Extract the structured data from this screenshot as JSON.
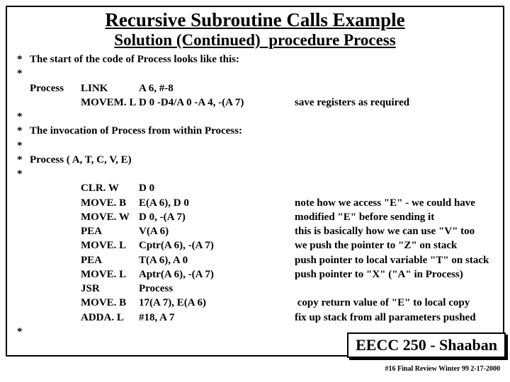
{
  "title": "Recursive Subroutine Calls Example",
  "subtitle": "Solution (Continued)  procedure Process",
  "lines": {
    "intro": "The start of the code of Process looks like this:",
    "proc_label": "Process",
    "link_op": "LINK",
    "link_arg": "A 6, #-8",
    "movem_op": "MOVEM. L",
    "movem_arg": "D 0 -D4/A 0 -A 4, -(A 7)",
    "save_note": "save registers as required",
    "invoke": "The invocation of Process from within Process:",
    "call": "Process ( A, T, C, V, E)"
  },
  "rows": [
    {
      "op": "CLR. W",
      "arg": "D 0",
      "note": ""
    },
    {
      "op": "MOVE. B",
      "arg": "E(A 6), D 0",
      "note": "note how we access  \"E\" - we could have"
    },
    {
      "op": "MOVE. W",
      "arg": "D 0, -(A 7)",
      "note": "modified  \"E\" before sending it"
    },
    {
      "op": "PEA",
      "arg": "V(A 6)",
      "note": "this is basically how we can use \"V\" too"
    },
    {
      "op": "MOVE. L",
      "arg": "Cptr(A 6), -(A 7)",
      "note": "we push the pointer to  \"Z\" on stack"
    },
    {
      "op": "PEA",
      "arg": "T(A 6), A 0",
      "note": "push pointer to local variable  \"T\" on stack"
    },
    {
      "op": "MOVE. L",
      "arg": "Aptr(A 6), -(A 7)",
      "note": "push pointer to  \"X\"  (\"A\" in Process)"
    },
    {
      "op": "JSR",
      "arg": "Process",
      "note": ""
    },
    {
      "op": "MOVE. B",
      "arg": "17(A 7), E(A 6)",
      "note": " copy return value of  \"E\" to local copy"
    },
    {
      "op": "ADDA. L",
      "arg": "#18, A 7",
      "note": "fix up stack from all parameters pushed"
    }
  ],
  "footer": "EECC 250 - Shaaban",
  "pagefoot": "#16  Final Review  Winter 99  2-17-2000"
}
